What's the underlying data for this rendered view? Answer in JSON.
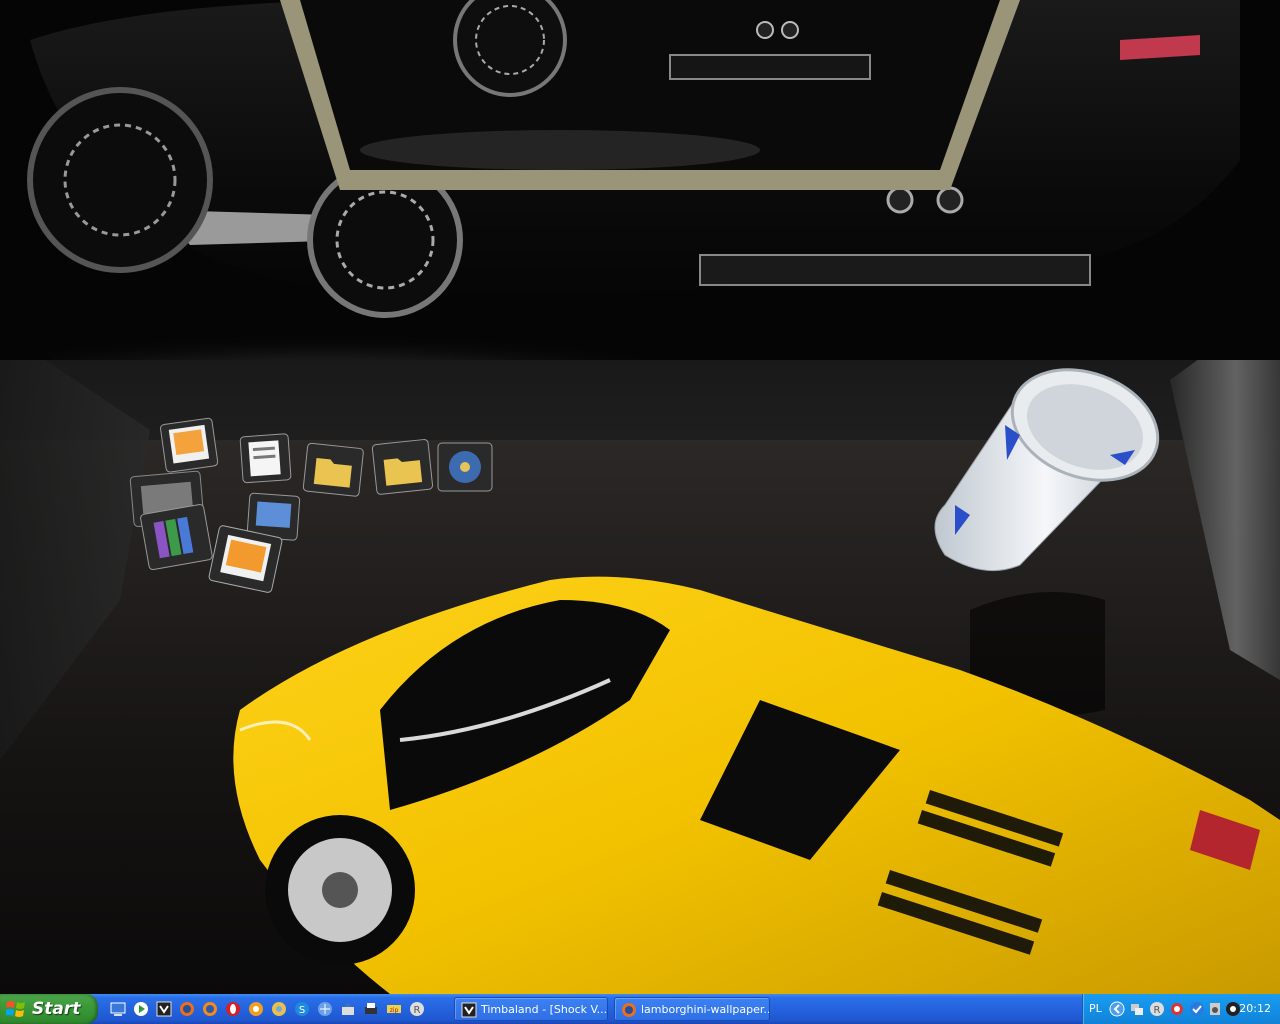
{
  "desktop": {
    "wallpaper": "lamborghini-wallpaper",
    "room_colors": {
      "floor": "#1a1817",
      "wall": "#101010"
    },
    "car_color": "#f2c200",
    "icons": [
      "photo-icon",
      "folder-icon",
      "text-document-icon",
      "picture-icon",
      "folder-icon",
      "film-reel-icon",
      "archive-icon",
      "winrar-icon",
      "photo-icon",
      "monitor-icon",
      "image-icon"
    ],
    "recycle_bin": "recycle-bin-icon"
  },
  "taskbar": {
    "start_label": "Start",
    "quick_launch": [
      "show-desktop-icon",
      "media-player-icon",
      "winamp-icon",
      "firefox-icon",
      "firefox-icon",
      "opera-icon",
      "email-icon",
      "chat-icon",
      "skype-icon",
      "network-icon",
      "tools-icon",
      "printer-icon",
      "zip-icon",
      "registry-icon"
    ],
    "tasks": [
      {
        "label": "Timbaland - [Shock V...",
        "icon": "winamp-icon"
      },
      {
        "label": "lamborghini-wallpaper...",
        "icon": "firefox-icon"
      }
    ],
    "tray": {
      "language": "PL",
      "clock": "20:12",
      "icons": [
        "chevron-left-icon",
        "network-icon",
        "registry-icon",
        "security-icon",
        "checkmark-icon",
        "volume-icon",
        "speaker-icon"
      ]
    }
  }
}
